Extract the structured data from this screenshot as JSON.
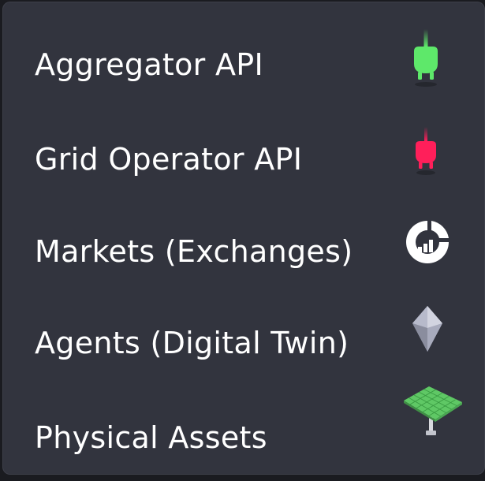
{
  "menu": {
    "items": [
      {
        "label": "Aggregator API",
        "icon": "plug-icon",
        "icon_color": "#5ee86a"
      },
      {
        "label": "Grid Operator API",
        "icon": "plug-icon",
        "icon_color": "#ff1f5a"
      },
      {
        "label": "Markets (Exchanges)",
        "icon": "market-chart-icon",
        "icon_color": "#ffffff"
      },
      {
        "label": "Agents (Digital Twin)",
        "icon": "crystal-icon",
        "icon_color": "#b9bccb"
      },
      {
        "label": "Physical Assets",
        "icon": "solar-panel-icon",
        "icon_color": "#7ee082"
      }
    ]
  }
}
